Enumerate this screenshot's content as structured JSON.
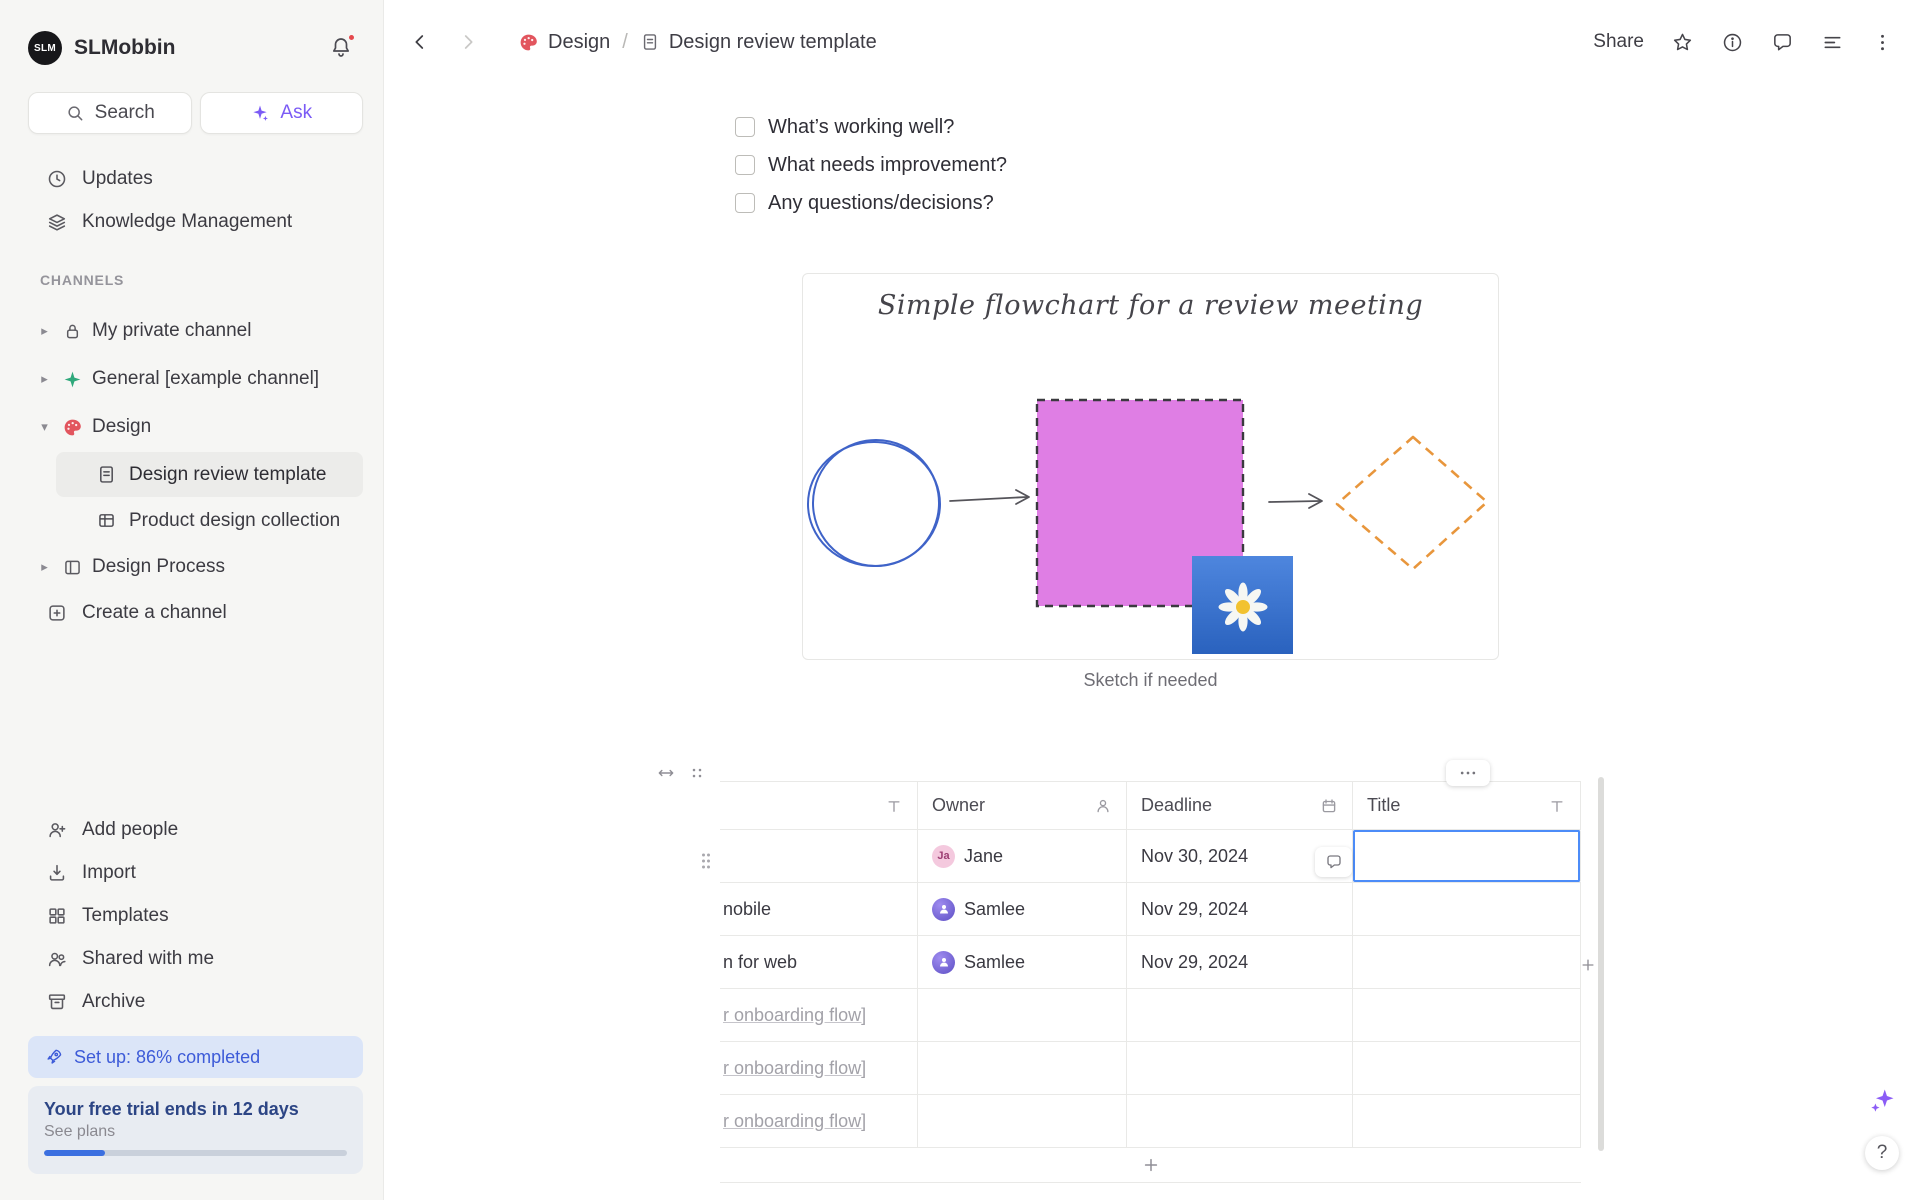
{
  "sidebar": {
    "workspace_name": "SLMobbin",
    "workspace_initials": "SLM",
    "search_label": "Search",
    "ask_label": "Ask",
    "updates_label": "Updates",
    "knowledge_label": "Knowledge Management",
    "channels_header": "CHANNELS",
    "channels": [
      {
        "label": "My private channel"
      },
      {
        "label": "General [example channel]"
      },
      {
        "label": "Design"
      },
      {
        "label": "Design review template"
      },
      {
        "label": "Product design collection"
      },
      {
        "label": "Design Process"
      },
      {
        "label": "Create a channel"
      }
    ],
    "footer_items": [
      {
        "label": "Add people"
      },
      {
        "label": "Import"
      },
      {
        "label": "Templates"
      },
      {
        "label": "Shared with me"
      },
      {
        "label": "Archive"
      }
    ],
    "setup_banner_label": "Set up: 86% completed",
    "trial": {
      "title": "Your free trial ends in 12 days",
      "link_label": "See plans",
      "progress_percent": 20
    }
  },
  "topbar": {
    "breadcrumb_channel": "Design",
    "breadcrumb_separator": "/",
    "breadcrumb_page": "Design review template",
    "share_label": "Share"
  },
  "document": {
    "checklist": [
      {
        "label": "What’s working well?",
        "checked": false
      },
      {
        "label": "What needs improvement?",
        "checked": false
      },
      {
        "label": "Any questions/decisions?",
        "checked": false
      }
    ],
    "sketch_title": "Simple flowchart for a review meeting",
    "sketch_caption": "Sketch if needed"
  },
  "table": {
    "columns": [
      {
        "label": "",
        "type": "text"
      },
      {
        "label": "Owner",
        "type": "person"
      },
      {
        "label": "Deadline",
        "type": "calendar"
      },
      {
        "label": "Title",
        "type": "text"
      }
    ],
    "rows": [
      {
        "name": "",
        "owner": "Jane",
        "owner_initials": "Ja",
        "deadline": "Nov 30, 2024",
        "title": ""
      },
      {
        "name": "nobile",
        "owner": "Samlee",
        "deadline": "Nov 29, 2024",
        "title": ""
      },
      {
        "name": "n for web",
        "owner": "Samlee",
        "deadline": "Nov 29, 2024",
        "title": ""
      },
      {
        "name": "r onboarding flow]",
        "owner": "",
        "deadline": "",
        "title": ""
      },
      {
        "name": "r onboarding flow]",
        "owner": "",
        "deadline": "",
        "title": ""
      },
      {
        "name": "r onboarding flow]",
        "owner": "",
        "deadline": "",
        "title": ""
      }
    ]
  },
  "icons": {
    "help": "?",
    "chevron_expanded": "▾",
    "chevron_collapsed": "▸"
  },
  "colors": {
    "accent_purple": "#7B5BF5",
    "selection_blue": "#4C8CF8",
    "setup_text_blue": "#3D5BD8",
    "square_fill": "#DF7EE4",
    "diamond_stroke": "#E8963C",
    "circle_stroke": "#3F63C8",
    "notification_red": "#E5484D"
  }
}
